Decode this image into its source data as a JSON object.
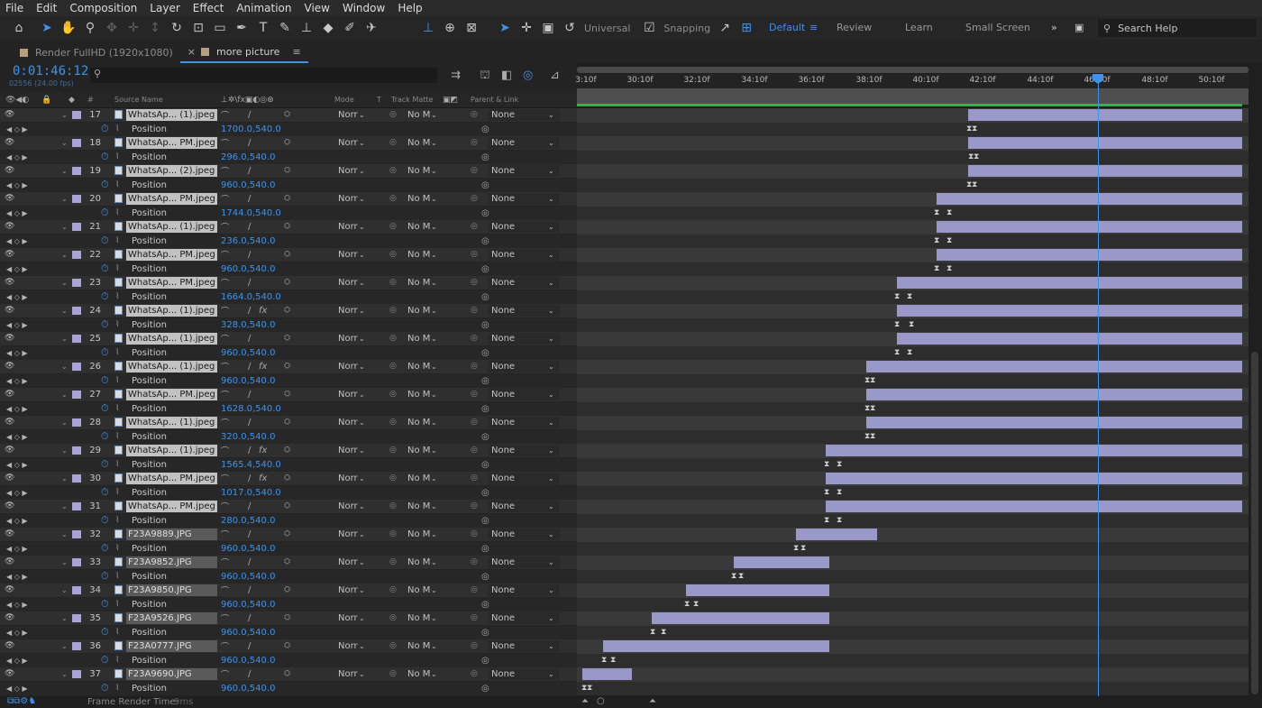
{
  "menu": [
    "File",
    "Edit",
    "Composition",
    "Layer",
    "Effect",
    "Animation",
    "View",
    "Window",
    "Help"
  ],
  "toolbar": {
    "universal": "Universal",
    "snapping": "Snapping"
  },
  "workspaces": {
    "default": "Default",
    "review": "Review",
    "learn": "Learn",
    "small": "Small Screen"
  },
  "search_help": "Search Help",
  "tabs": [
    {
      "label": "Render FullHD (1920x1080)"
    },
    {
      "label": "more picture"
    }
  ],
  "timecode": "0:01:46:12",
  "fps": "02556 (24.00 fps)",
  "search_value": "",
  "headers": {
    "source_name": "Source Name",
    "mode": "Mode",
    "t": "T",
    "track_matte": "Track Matte",
    "parent": "Parent & Link",
    "num": "#"
  },
  "ruler": [
    "3:10f",
    "30:10f",
    "32:10f",
    "34:10f",
    "36:10f",
    "38:10f",
    "40:10f",
    "42:10f",
    "44:10f",
    "46:10f",
    "48:10f",
    "50:10f"
  ],
  "layers": [
    {
      "num": "17",
      "name": "WhatsAp... (1).jpeg",
      "pos": "1700.0,540.0",
      "fx": false,
      "bar": [
        434,
        738
      ],
      "keys": [
        432,
        438
      ]
    },
    {
      "num": "18",
      "name": "WhatsAp... PM.jpeg",
      "pos": "296.0,540.0",
      "fx": false,
      "bar": [
        434,
        738
      ],
      "keys": [
        434,
        440
      ]
    },
    {
      "num": "19",
      "name": "WhatsAp... (2).jpeg",
      "pos": "960.0,540.0",
      "fx": false,
      "bar": [
        434,
        738
      ],
      "keys": [
        432,
        438
      ]
    },
    {
      "num": "20",
      "name": "WhatsAp... PM.jpeg",
      "pos": "1744.0,540.0",
      "fx": false,
      "bar": [
        399,
        738
      ],
      "keys": [
        396,
        410
      ]
    },
    {
      "num": "21",
      "name": "WhatsAp... (1).jpeg",
      "pos": "236.0,540.0",
      "fx": false,
      "bar": [
        399,
        738
      ],
      "keys": [
        396,
        410
      ]
    },
    {
      "num": "22",
      "name": "WhatsAp... PM.jpeg",
      "pos": "960.0,540.0",
      "fx": false,
      "bar": [
        399,
        738
      ],
      "keys": [
        396,
        410
      ]
    },
    {
      "num": "23",
      "name": "WhatsAp... PM.jpeg",
      "pos": "1664.0,540.0",
      "fx": false,
      "bar": [
        355,
        738
      ],
      "keys": [
        352,
        366
      ]
    },
    {
      "num": "24",
      "name": "WhatsAp... (1).jpeg",
      "pos": "328.0,540.0",
      "fx": true,
      "bar": [
        355,
        738
      ],
      "keys": [
        352,
        368
      ]
    },
    {
      "num": "25",
      "name": "WhatsAp... (1).jpeg",
      "pos": "960.0,540.0",
      "fx": false,
      "bar": [
        355,
        738
      ],
      "keys": [
        352,
        366
      ]
    },
    {
      "num": "26",
      "name": "WhatsAp... (1).jpeg",
      "pos": "960.0,540.0",
      "fx": true,
      "bar": [
        321,
        738
      ],
      "keys": [
        319,
        325
      ]
    },
    {
      "num": "27",
      "name": "WhatsAp... PM.jpeg",
      "pos": "1628.0,540.0",
      "fx": false,
      "bar": [
        321,
        738
      ],
      "keys": [
        319,
        325
      ]
    },
    {
      "num": "28",
      "name": "WhatsAp... (1).jpeg",
      "pos": "320.0,540.0",
      "fx": false,
      "bar": [
        321,
        738
      ],
      "keys": [
        319,
        325
      ]
    },
    {
      "num": "29",
      "name": "WhatsAp... (1).jpeg",
      "pos": "1565.4,540.0",
      "fx": true,
      "bar": [
        276,
        738
      ],
      "keys": [
        274,
        288
      ]
    },
    {
      "num": "30",
      "name": "WhatsAp... PM.jpeg",
      "pos": "1017.0,540.0",
      "fx": true,
      "bar": [
        276,
        738
      ],
      "keys": [
        274,
        288
      ]
    },
    {
      "num": "31",
      "name": "WhatsAp... PM.jpeg",
      "pos": "280.0,540.0",
      "fx": false,
      "bar": [
        276,
        738
      ],
      "keys": [
        274,
        288
      ]
    },
    {
      "num": "32",
      "name": "F23A9889.JPG",
      "pos": "960.0,540.0",
      "fx": false,
      "bar": [
        243,
        333
      ],
      "keys": [
        240,
        248
      ]
    },
    {
      "num": "33",
      "name": "F23A9852.JPG",
      "pos": "960.0,540.0",
      "fx": false,
      "bar": [
        174,
        280
      ],
      "keys": [
        171,
        179
      ]
    },
    {
      "num": "34",
      "name": "F23A9850.JPG",
      "pos": "960.0,540.0",
      "fx": false,
      "bar": [
        121,
        280
      ],
      "keys": [
        119,
        129
      ]
    },
    {
      "num": "35",
      "name": "F23A9526.JPG",
      "pos": "960.0,540.0",
      "fx": false,
      "bar": [
        83,
        280
      ],
      "keys": [
        81,
        93
      ]
    },
    {
      "num": "36",
      "name": "F23A0777.JPG",
      "pos": "960.0,540.0",
      "fx": false,
      "bar": [
        29,
        280
      ],
      "keys": [
        27,
        37
      ]
    },
    {
      "num": "37",
      "name": "F23A9690.JPG",
      "pos": "960.0,540.0",
      "fx": false,
      "bar": [
        6,
        61
      ],
      "keys": [
        5,
        11
      ]
    }
  ],
  "labels": {
    "mode": "Norr",
    "tm": "No M",
    "parent": "None",
    "position": "Position"
  },
  "status": {
    "label": "Frame Render Time:",
    "value": "9ms"
  }
}
